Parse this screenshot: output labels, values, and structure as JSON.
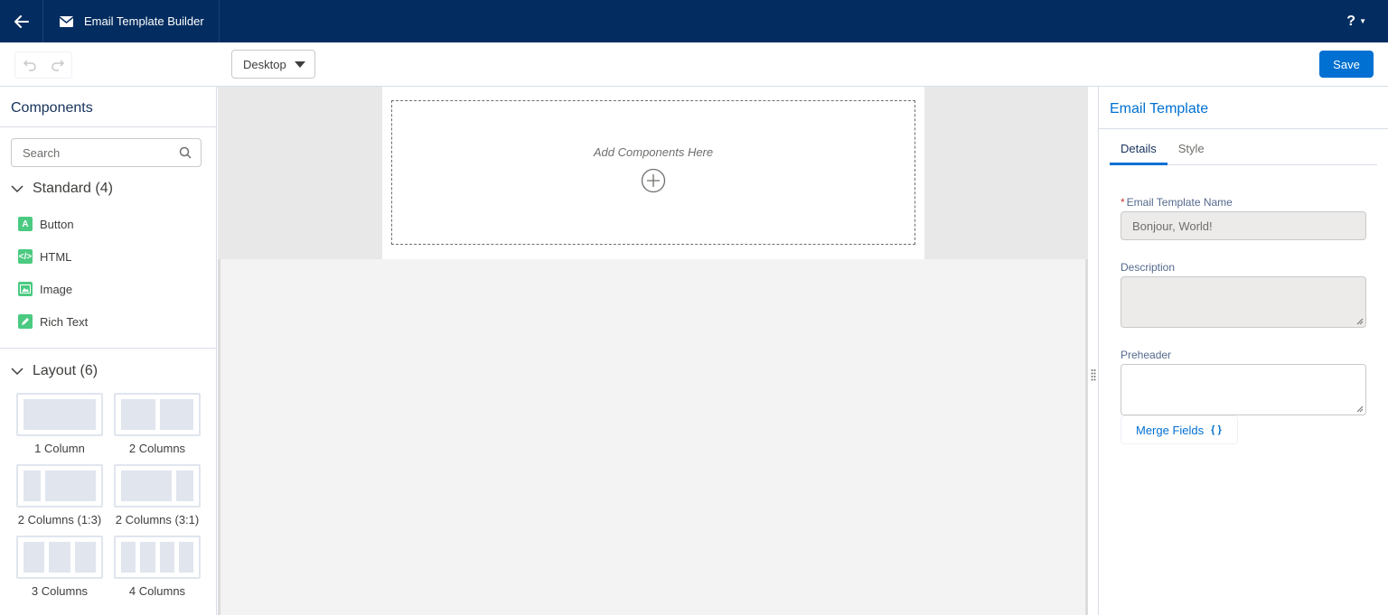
{
  "header": {
    "app_title": "Email Template Builder",
    "help_label": "?"
  },
  "toolbar": {
    "device_value": "Desktop",
    "save_label": "Save"
  },
  "left_panel": {
    "title": "Components",
    "search_placeholder": "Search",
    "standard_heading": "Standard (4)",
    "standard_items": [
      {
        "label": "Button",
        "icon": "button-icon"
      },
      {
        "label": "HTML",
        "icon": "html-code-icon"
      },
      {
        "label": "Image",
        "icon": "image-icon"
      },
      {
        "label": "Rich Text",
        "icon": "pencil-icon"
      }
    ],
    "layout_heading": "Layout (6)",
    "layout_items": [
      {
        "label": "1 Column"
      },
      {
        "label": "2 Columns"
      },
      {
        "label": "2 Columns (1:3)"
      },
      {
        "label": "2 Columns (3:1)"
      },
      {
        "label": "3 Columns"
      },
      {
        "label": "4 Columns"
      }
    ]
  },
  "canvas": {
    "drop_hint": "Add Components Here"
  },
  "right_panel": {
    "title": "Email Template",
    "tabs": [
      {
        "label": "Details"
      },
      {
        "label": "Style"
      }
    ],
    "name_label": "Email Template Name",
    "name_value": "Bonjour, World!",
    "description_label": "Description",
    "preheader_label": "Preheader",
    "merge_fields_label": "Merge Fields",
    "merge_fields_icon": "{ }"
  },
  "colors": {
    "header_bg": "#032d60",
    "brand_blue": "#0070d2",
    "component_icon_green": "#4bca81"
  }
}
